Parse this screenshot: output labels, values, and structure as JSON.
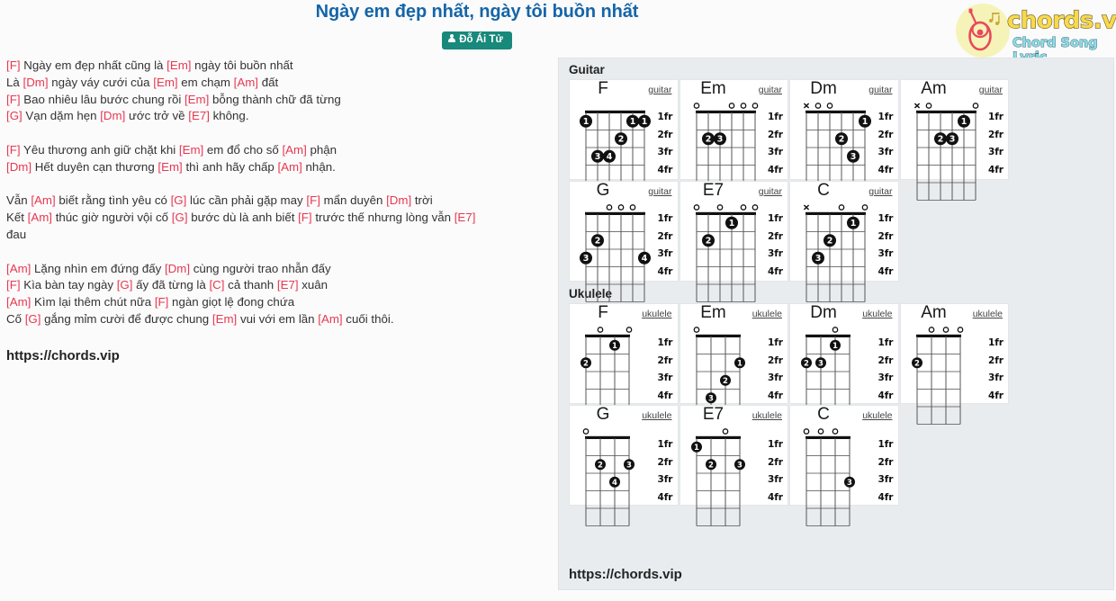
{
  "header": {
    "title": "Ngày em đẹp nhất, ngày tôi buồn nhất",
    "author": "Đỗ Ái Tử"
  },
  "logo": {
    "brand": "chords.vip",
    "tagline": "Chord Song Lyric",
    "circle_color": "#f6f3b8",
    "brand_color": "#f7d94c",
    "tagline_color": "#8fdce8",
    "guitar_color": "#e8495c"
  },
  "colors": {
    "title": "#1565a8",
    "chord": "#e8384f",
    "badge": "#18897b",
    "panel_bg": "#e9ecef"
  },
  "lyrics": {
    "url": "https://chords.vip",
    "lines": [
      [
        {
          "c": "[F]"
        },
        {
          "t": " Ngày em đẹp nhất cũng là "
        },
        {
          "c": "[Em]"
        },
        {
          "t": " ngày tôi buồn nhất"
        }
      ],
      [
        {
          "t": "Là "
        },
        {
          "c": "[Dm]"
        },
        {
          "t": " ngày váy cưới của "
        },
        {
          "c": "[Em]"
        },
        {
          "t": " em chạm "
        },
        {
          "c": "[Am]"
        },
        {
          "t": " đất"
        }
      ],
      [
        {
          "c": "[F]"
        },
        {
          "t": " Bao nhiêu lâu bước chung rồi "
        },
        {
          "c": "[Em]"
        },
        {
          "t": " bỗng thành chữ đã từng"
        }
      ],
      [
        {
          "c": "[G]"
        },
        {
          "t": " Vạn dặm hẹn "
        },
        {
          "c": "[Dm]"
        },
        {
          "t": " ước trở về "
        },
        {
          "c": "[E7]"
        },
        {
          "t": " không."
        }
      ],
      [],
      [
        {
          "c": "[F]"
        },
        {
          "t": " Yêu thương anh giữ chặt khi "
        },
        {
          "c": "[Em]"
        },
        {
          "t": " em đổ cho số "
        },
        {
          "c": "[Am]"
        },
        {
          "t": " phận"
        }
      ],
      [
        {
          "c": "[Dm]"
        },
        {
          "t": " Hết duyên cạn thương "
        },
        {
          "c": "[Em]"
        },
        {
          "t": " thì anh hãy chấp "
        },
        {
          "c": "[Am]"
        },
        {
          "t": " nhận."
        }
      ],
      [],
      [
        {
          "t": "Vẫn "
        },
        {
          "c": "[Am]"
        },
        {
          "t": " biết rằng tình yêu có "
        },
        {
          "c": "[G]"
        },
        {
          "t": " lúc cần phải gặp may "
        },
        {
          "c": "[F]"
        },
        {
          "t": " mẩn duyên "
        },
        {
          "c": "[Dm]"
        },
        {
          "t": " trời"
        }
      ],
      [
        {
          "t": "Kết "
        },
        {
          "c": "[Am]"
        },
        {
          "t": " thúc giờ người vội cố "
        },
        {
          "c": "[G]"
        },
        {
          "t": " bước dù là anh biết "
        },
        {
          "c": "[F]"
        },
        {
          "t": " trước thế nhưng lòng vẫn "
        },
        {
          "c": "[E7]"
        }
      ],
      [
        {
          "t": "đau"
        }
      ],
      [],
      [
        {
          "c": "[Am]"
        },
        {
          "t": " Lặng nhìn em đứng đấy "
        },
        {
          "c": "[Dm]"
        },
        {
          "t": " cùng người trao nhẫn đấy"
        }
      ],
      [
        {
          "c": "[F]"
        },
        {
          "t": " Kìa bàn tay ngày "
        },
        {
          "c": "[G]"
        },
        {
          "t": " ấy đã từng là "
        },
        {
          "c": "[C]"
        },
        {
          "t": " cả thanh "
        },
        {
          "c": "[E7]"
        },
        {
          "t": " xuân"
        }
      ],
      [
        {
          "c": "[Am]"
        },
        {
          "t": " Kìm lại thêm chút nữa "
        },
        {
          "c": "[F]"
        },
        {
          "t": " ngàn giọt lệ đong chứa"
        }
      ],
      [
        {
          "t": "Cố "
        },
        {
          "c": "[G]"
        },
        {
          "t": " gắng mỉm cười để được chung "
        },
        {
          "c": "[Em]"
        },
        {
          "t": " vui với em lần "
        },
        {
          "c": "[Am]"
        },
        {
          "t": " cuối thôi."
        }
      ]
    ]
  },
  "chord_panel": {
    "url": "https://chords.vip",
    "guitar_label": "Guitar",
    "ukulele_label": "Ukulele",
    "fret_labels": [
      "1fr",
      "2fr",
      "3fr",
      "4fr"
    ],
    "guitar": [
      {
        "name": "F",
        "instrument": "guitar",
        "strings": 6,
        "top": [
          "",
          "",
          "",
          "",
          "",
          ""
        ],
        "dots": [
          {
            "string": 6,
            "fret": 1,
            "finger": "1"
          },
          {
            "string": 3,
            "fret": 2,
            "finger": "2"
          },
          {
            "string": 5,
            "fret": 3,
            "finger": "3"
          },
          {
            "string": 4,
            "fret": 3,
            "finger": "4"
          },
          {
            "string": 2,
            "fret": 1,
            "finger": "1"
          },
          {
            "string": 1,
            "fret": 1,
            "finger": "1"
          }
        ]
      },
      {
        "name": "Em",
        "instrument": "guitar",
        "strings": 6,
        "top": [
          "o",
          "",
          "",
          "o",
          "o",
          "o"
        ],
        "dots": [
          {
            "string": 5,
            "fret": 2,
            "finger": "2"
          },
          {
            "string": 4,
            "fret": 2,
            "finger": "3"
          }
        ]
      },
      {
        "name": "Dm",
        "instrument": "guitar",
        "strings": 6,
        "top": [
          "x",
          "o",
          "o",
          "",
          "",
          ""
        ],
        "dots": [
          {
            "string": 1,
            "fret": 1,
            "finger": "1"
          },
          {
            "string": 3,
            "fret": 2,
            "finger": "2"
          },
          {
            "string": 2,
            "fret": 3,
            "finger": "3"
          }
        ]
      },
      {
        "name": "Am",
        "instrument": "guitar",
        "strings": 6,
        "top": [
          "x",
          "o",
          "",
          "",
          "",
          "o"
        ],
        "dots": [
          {
            "string": 2,
            "fret": 1,
            "finger": "1"
          },
          {
            "string": 4,
            "fret": 2,
            "finger": "2"
          },
          {
            "string": 3,
            "fret": 2,
            "finger": "3"
          }
        ]
      },
      {
        "name": "G",
        "instrument": "guitar",
        "strings": 6,
        "top": [
          "",
          "",
          "o",
          "o",
          "o",
          ""
        ],
        "dots": [
          {
            "string": 5,
            "fret": 2,
            "finger": "2"
          },
          {
            "string": 6,
            "fret": 3,
            "finger": "3"
          },
          {
            "string": 1,
            "fret": 3,
            "finger": "4"
          }
        ]
      },
      {
        "name": "E7",
        "instrument": "guitar",
        "strings": 6,
        "top": [
          "o",
          "",
          "o",
          "",
          "o",
          "o"
        ],
        "dots": [
          {
            "string": 3,
            "fret": 1,
            "finger": "1"
          },
          {
            "string": 5,
            "fret": 2,
            "finger": "2"
          }
        ]
      },
      {
        "name": "C",
        "instrument": "guitar",
        "strings": 6,
        "top": [
          "x",
          "",
          "",
          "o",
          "",
          "o"
        ],
        "dots": [
          {
            "string": 2,
            "fret": 1,
            "finger": "1"
          },
          {
            "string": 4,
            "fret": 2,
            "finger": "2"
          },
          {
            "string": 5,
            "fret": 3,
            "finger": "3"
          }
        ]
      }
    ],
    "ukulele": [
      {
        "name": "F",
        "instrument": "ukulele",
        "strings": 4,
        "top": [
          "",
          "o",
          "",
          "o"
        ],
        "dots": [
          {
            "string": 2,
            "fret": 1,
            "finger": "1"
          },
          {
            "string": 4,
            "fret": 2,
            "finger": "2"
          }
        ]
      },
      {
        "name": "Em",
        "instrument": "ukulele",
        "strings": 4,
        "top": [
          "o",
          "",
          "",
          ""
        ],
        "dots": [
          {
            "string": 1,
            "fret": 2,
            "finger": "1"
          },
          {
            "string": 2,
            "fret": 3,
            "finger": "2"
          },
          {
            "string": 3,
            "fret": 4,
            "finger": "3"
          }
        ]
      },
      {
        "name": "Dm",
        "instrument": "ukulele",
        "strings": 4,
        "top": [
          "",
          "",
          "o",
          ""
        ],
        "dots": [
          {
            "string": 2,
            "fret": 1,
            "finger": "1"
          },
          {
            "string": 4,
            "fret": 2,
            "finger": "2"
          },
          {
            "string": 3,
            "fret": 2,
            "finger": "3"
          }
        ]
      },
      {
        "name": "Am",
        "instrument": "ukulele",
        "strings": 4,
        "top": [
          "",
          "o",
          "o",
          "o"
        ],
        "dots": [
          {
            "string": 4,
            "fret": 2,
            "finger": "2"
          }
        ]
      },
      {
        "name": "G",
        "instrument": "ukulele",
        "strings": 4,
        "top": [
          "o",
          "",
          "",
          ""
        ],
        "dots": [
          {
            "string": 3,
            "fret": 2,
            "finger": "2"
          },
          {
            "string": 1,
            "fret": 2,
            "finger": "3"
          },
          {
            "string": 2,
            "fret": 3,
            "finger": "4"
          }
        ]
      },
      {
        "name": "E7",
        "instrument": "ukulele",
        "strings": 4,
        "top": [
          "",
          "",
          "o",
          ""
        ],
        "dots": [
          {
            "string": 4,
            "fret": 1,
            "finger": "1"
          },
          {
            "string": 3,
            "fret": 2,
            "finger": "2"
          },
          {
            "string": 1,
            "fret": 2,
            "finger": "3"
          }
        ]
      },
      {
        "name": "C",
        "instrument": "ukulele",
        "strings": 4,
        "top": [
          "o",
          "o",
          "o",
          ""
        ],
        "dots": [
          {
            "string": 1,
            "fret": 3,
            "finger": "3"
          }
        ]
      }
    ]
  }
}
